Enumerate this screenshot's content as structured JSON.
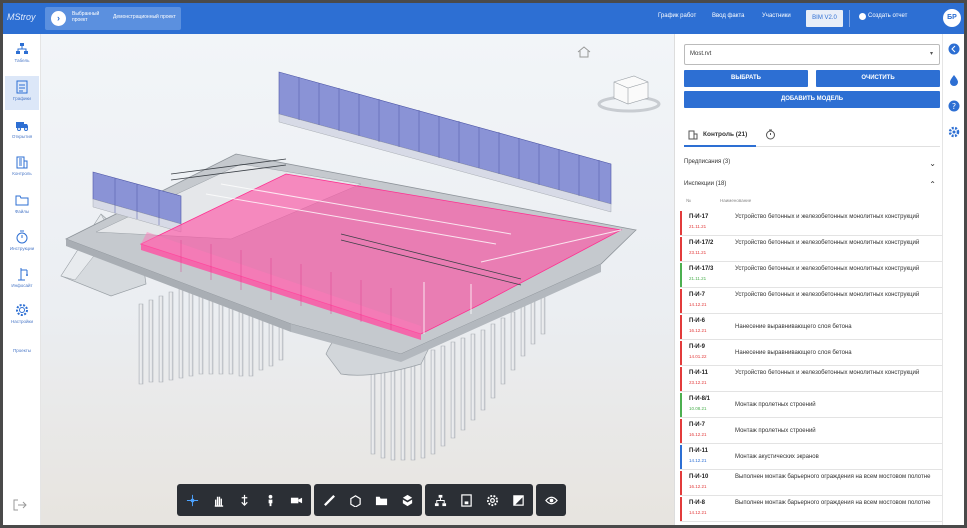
{
  "app": {
    "logo": "MStroy"
  },
  "project": {
    "label": "Выбранный проект",
    "name": "Демонстрационный проект"
  },
  "nav": {
    "items": [
      "График работ",
      "Ввод факта",
      "Участники"
    ],
    "bim_label": "BIM V2.0",
    "create_report": "Создать отчет",
    "user_initials": "БР"
  },
  "sidebar": {
    "items": [
      {
        "label": "Табель",
        "icon": "org-chart-icon"
      },
      {
        "label": "Графики",
        "icon": "document-icon",
        "active": true
      },
      {
        "label": "Открытия",
        "icon": "truck-icon"
      },
      {
        "label": "Контроль",
        "icon": "building-icon"
      },
      {
        "label": "Файлы",
        "icon": "folder-icon"
      },
      {
        "label": "Инструкции",
        "icon": "clock-icon"
      },
      {
        "label": "Инфосайт",
        "icon": "crane-icon"
      },
      {
        "label": "Настройки",
        "icon": "gear-icon"
      },
      {
        "label": "Проекты",
        "icon": ""
      }
    ]
  },
  "panel": {
    "model_select": "Most.rvt",
    "btn_select": "ВЫБРАТЬ",
    "btn_clear": "ОЧИСТИТЬ",
    "btn_add_model": "ДОБАВИТЬ МОДЕЛЬ",
    "tab_control": "Контроль (21)",
    "section_prescriptions": "Предписания (3)",
    "section_inspections": "Инспекции (18)",
    "col_no": "№",
    "col_name": "Наименование",
    "inspections": [
      {
        "code": "П-И-17",
        "date": "21.11.21",
        "name": "Устройство бетонных и железобетонных монолитных конструкций",
        "status": "#e23b3b"
      },
      {
        "code": "П-И-17/2",
        "date": "23.11.21",
        "name": "Устройство бетонных и железобетонных монолитных конструкций",
        "status": "#e23b3b"
      },
      {
        "code": "П-И-17/3",
        "date": "21.11.21",
        "name": "Устройство бетонных и железобетонных монолитных конструкций",
        "status": "#4caf50"
      },
      {
        "code": "П-И-7",
        "date": "14.12.21",
        "name": "Устройство бетонных и железобетонных монолитных конструкций",
        "status": "#e23b3b"
      },
      {
        "code": "П-И-6",
        "date": "16.12.21",
        "name": "Нанесение выравнивающего слоя бетона",
        "status": "#e23b3b"
      },
      {
        "code": "П-И-9",
        "date": "14.01.22",
        "name": "Нанесение выравнивающего слоя бетона",
        "status": "#e23b3b"
      },
      {
        "code": "П-И-11",
        "date": "23.12.21",
        "name": "Устройство бетонных и железобетонных монолитных конструкций",
        "status": "#e23b3b"
      },
      {
        "code": "П-И-8/1",
        "date": "10.08.21",
        "name": "Монтаж пролетных строений",
        "status": "#4caf50"
      },
      {
        "code": "П-И-7",
        "date": "16.12.21",
        "name": "Монтаж пролетных строений",
        "status": "#e23b3b"
      },
      {
        "code": "П-И-11",
        "date": "14.12.21",
        "name": "Монтаж акустических экранов",
        "status": "#2d6fd3"
      },
      {
        "code": "П-И-10",
        "date": "16.12.21",
        "name": "Выполнен монтаж барьерного ограждения на всем мостовом полотне",
        "status": "#e23b3b"
      },
      {
        "code": "П-И-8",
        "date": "14.12.21",
        "name": "Выполнен монтаж барьерного ограждения на всем мостовом полотне",
        "status": "#e23b3b"
      }
    ]
  },
  "toolbar": {
    "groups": [
      [
        "orbit-icon",
        "hand-pan-icon",
        "walk-down-icon",
        "person-icon",
        "camera-icon"
      ],
      [
        "ruler-icon",
        "section-box-icon",
        "folder-icon",
        "explode-icon"
      ],
      [
        "tree-icon",
        "properties-icon",
        "gear-icon",
        "fullscreen-icon"
      ],
      [
        "eye-icon"
      ]
    ]
  },
  "colors": {
    "accent": "#2d6fd3",
    "selection": "#ff4fa3"
  }
}
